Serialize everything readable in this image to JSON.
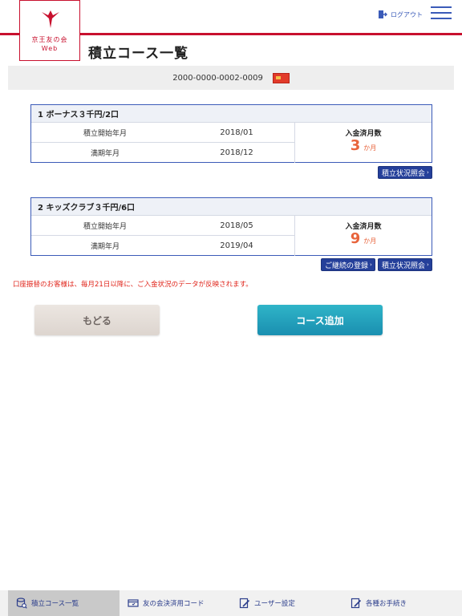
{
  "header": {
    "logo_line1": "京王友の会",
    "logo_line2": "Web",
    "logout_label": "ログアウト"
  },
  "page": {
    "title": "積立コース一覧"
  },
  "account": {
    "number": "2000-0000-0002-0009"
  },
  "courses": [
    {
      "name": "1 ボーナス３千円/2口",
      "start_label": "積立開始年月",
      "start_value": "2018/01",
      "end_label": "満期年月",
      "end_value": "2018/12",
      "paid_label": "入金済月数",
      "paid_count": "3",
      "paid_unit": "か月",
      "status_button": "積立状況照会"
    },
    {
      "name": "2 キッズクラブ３千円/6口",
      "start_label": "積立開始年月",
      "start_value": "2018/05",
      "end_label": "満期年月",
      "end_value": "2019/04",
      "paid_label": "入金済月数",
      "paid_count": "9",
      "paid_unit": "か月",
      "renew_button": "ご継続の登録",
      "status_button": "積立状況照会"
    }
  ],
  "notice": "口座振替のお客様は、毎月21日以降に、ご入金状況のデータが反映されます。",
  "actions": {
    "back": "もどる",
    "add_course": "コース追加"
  },
  "footer": {
    "items": [
      {
        "label": "積立コース一覧"
      },
      {
        "label": "友の会決済用コード"
      },
      {
        "label": "ユーザー設定"
      },
      {
        "label": "各種お手続き"
      }
    ]
  },
  "colors": {
    "brand_red": "#c8102e",
    "link_blue": "#243f9a",
    "accent_orange": "#e8643c",
    "notice_red": "#e0251b",
    "add_button": "#1a8fb0"
  }
}
